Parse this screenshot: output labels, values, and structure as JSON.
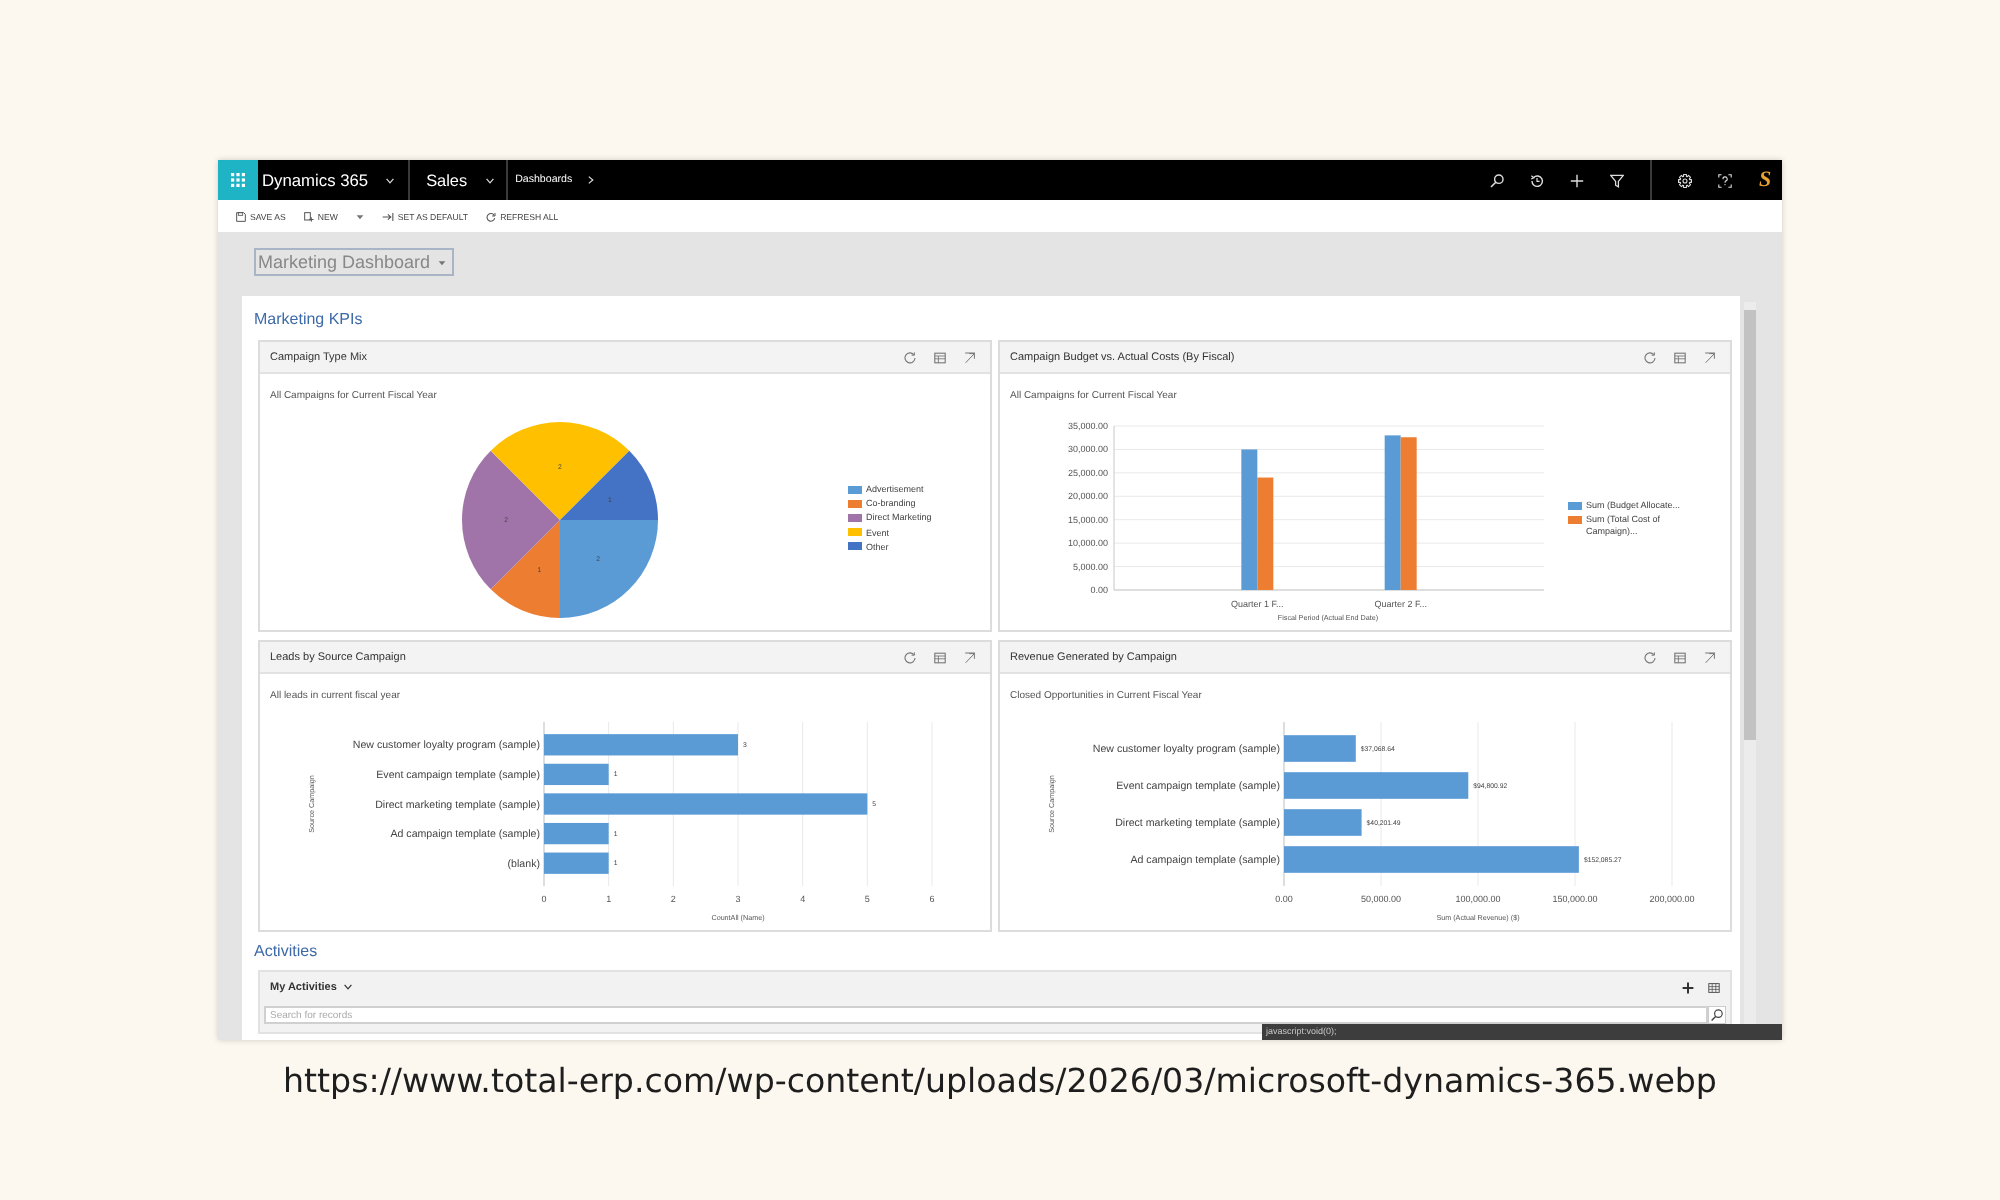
{
  "top_bar": {
    "app_name": "Dynamics 365",
    "area": "Sales",
    "breadcrumb": "Dashboards",
    "user_badge": "S"
  },
  "command_bar": [
    {
      "kind": "save",
      "label": "SAVE AS"
    },
    {
      "kind": "new",
      "label": "NEW"
    },
    {
      "kind": "menu"
    },
    {
      "kind": "pin",
      "label": "SET AS DEFAULT"
    },
    {
      "kind": "refresh",
      "label": "REFRESH ALL"
    }
  ],
  "dashboard_selector": {
    "value": "Marketing Dashboard"
  },
  "kpi_section": {
    "title": "Marketing KPIs",
    "cards": [
      {
        "title": "Campaign Type Mix",
        "subtitle": "All Campaigns for Current Fiscal Year",
        "chart_data": {
          "type": "pie",
          "categories": [
            "Advertisement",
            "Co-branding",
            "Direct Marketing",
            "Event",
            "Other"
          ],
          "values": [
            2,
            1,
            2,
            2,
            1
          ],
          "colors": [
            "#5b9bd5",
            "#ed7d31",
            "#a074a8",
            "#ffc000",
            "#4472c4"
          ],
          "data_labels": true,
          "legend": true
        }
      },
      {
        "title": "Campaign Budget vs. Actual Costs (By Fiscal)",
        "subtitle": "All Campaigns for Current Fiscal Year",
        "chart_data": {
          "type": "bar",
          "orientation": "vertical",
          "categories": [
            "Quarter 1 F...",
            "Quarter 2 F..."
          ],
          "series": [
            {
              "name": "Sum (Budget Allocate...",
              "color": "#5b9bd5",
              "values": [
                30000,
                33000
              ]
            },
            {
              "name": "Sum (Total Cost of Campaign)...",
              "color": "#ed7d31",
              "values": [
                24000,
                32600
              ]
            }
          ],
          "xlabel": "Fiscal Period (Actual End Date)",
          "ylim": [
            0,
            35000
          ],
          "yticks": [
            {
              "value": 0,
              "label": "0.00"
            },
            {
              "value": 5000,
              "label": "5,000.00"
            },
            {
              "value": 10000,
              "label": "10,000.00"
            },
            {
              "value": 15000,
              "label": "15,000.00"
            },
            {
              "value": 20000,
              "label": "20,000.00"
            },
            {
              "value": 25000,
              "label": "25,000.00"
            },
            {
              "value": 30000,
              "label": "30,000.00"
            },
            {
              "value": 35000,
              "label": "35,000.00"
            }
          ],
          "grid": true,
          "legend": true
        }
      },
      {
        "title": "Leads by Source Campaign",
        "subtitle": "All leads in current fiscal year",
        "chart_data": {
          "type": "bar",
          "orientation": "horizontal",
          "categories": [
            "New customer loyalty program (sample)",
            "Event campaign template (sample)",
            "Direct marketing template (sample)",
            "Ad campaign template (sample)",
            "(blank)"
          ],
          "series": [
            {
              "color": "#5b9bd5",
              "values": [
                3,
                1,
                5,
                1,
                1
              ]
            }
          ],
          "xlabel": "CountAll (Name)",
          "ylabel": "Source Campaign",
          "xlim": [
            0,
            6
          ],
          "xticks": [
            0,
            1,
            2,
            3,
            4,
            5,
            6
          ],
          "data_labels": true,
          "grid": true
        }
      },
      {
        "title": "Revenue Generated by Campaign",
        "subtitle": "Closed Opportunities in Current Fiscal Year",
        "chart_data": {
          "type": "bar",
          "orientation": "horizontal",
          "categories": [
            "New customer loyalty program (sample)",
            "Event campaign template (sample)",
            "Direct marketing template (sample)",
            "Ad campaign template (sample)"
          ],
          "series": [
            {
              "color": "#5b9bd5",
              "values": [
                37000,
                95000,
                40000,
                152000
              ]
            }
          ],
          "xlabel": "Sum (Actual Revenue) ($)",
          "ylabel": "Source Campaign",
          "xlim": [
            0,
            200000
          ],
          "xticks": [
            {
              "value": 0,
              "label": "0.00"
            },
            {
              "value": 50000,
              "label": "50,000.00"
            },
            {
              "value": 100000,
              "label": "100,000.00"
            },
            {
              "value": 150000,
              "label": "150,000.00"
            },
            {
              "value": 200000,
              "label": "200,000.00"
            }
          ],
          "value_labels": [
            "$37,068.64",
            "$94,800.92",
            "$40,201.49",
            "$152,085.27"
          ],
          "grid": true
        }
      }
    ]
  },
  "activities_section": {
    "title": "Activities",
    "view": "My Activities",
    "search": {
      "placeholder": "Search for records"
    }
  },
  "status_bar": "javascript:void(0);",
  "caption": "https://www.total-erp.com/wp-content/uploads/2026/03/microsoft-dynamics-365.webp"
}
